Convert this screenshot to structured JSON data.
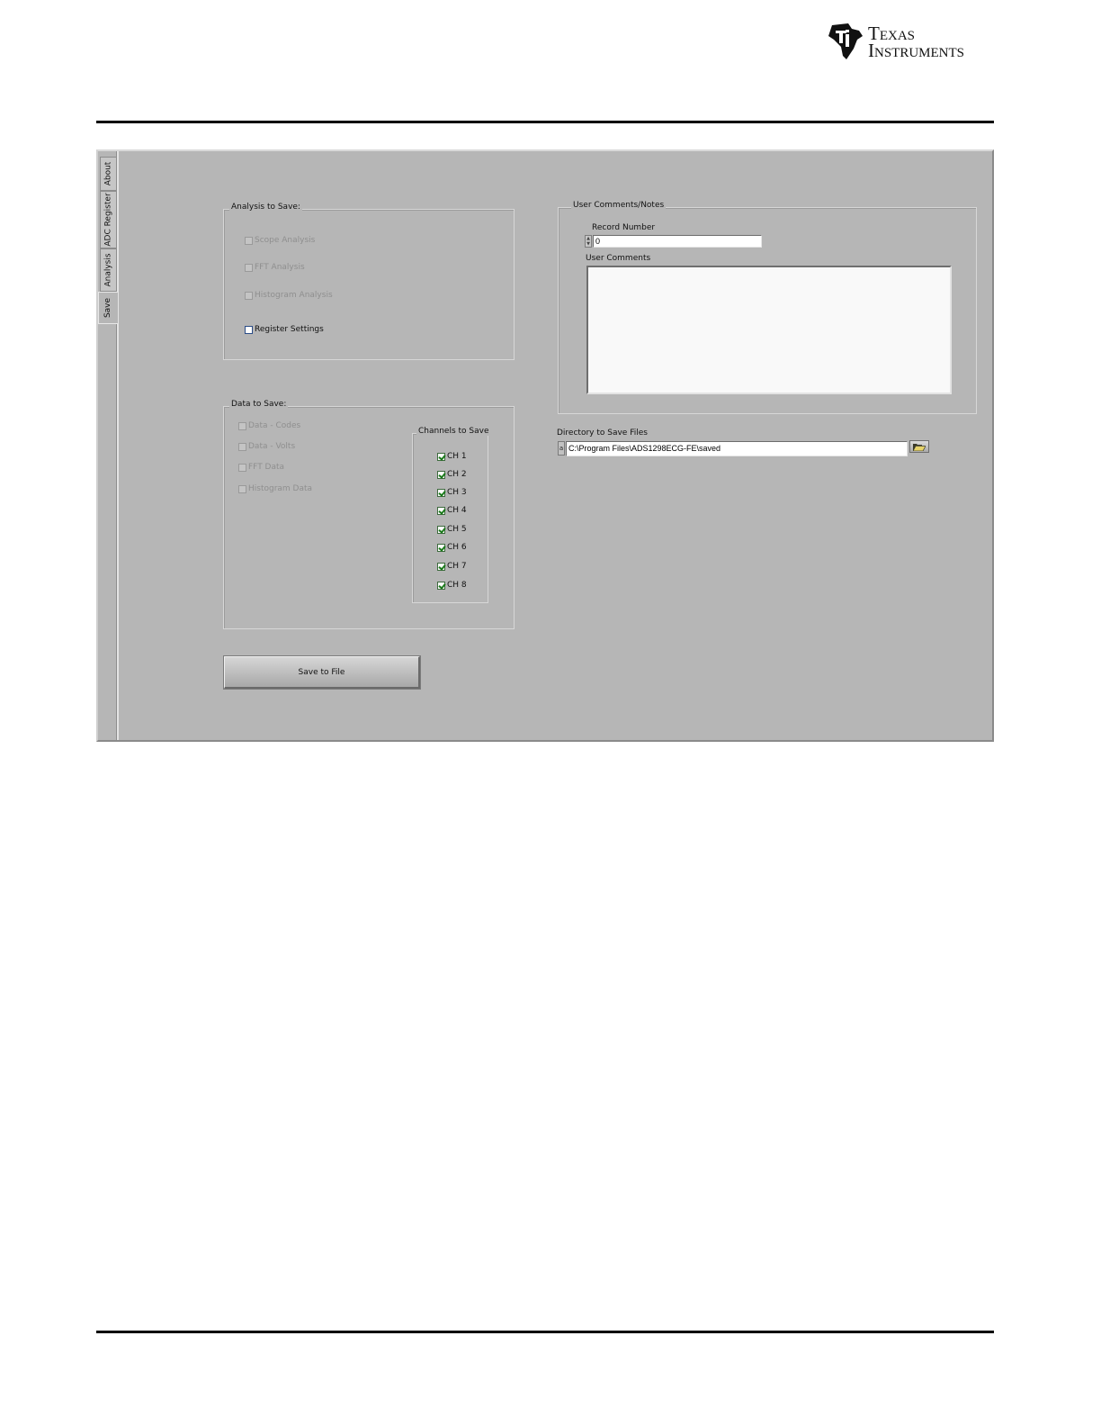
{
  "brand": {
    "line1": "Texas",
    "line2": "Instruments"
  },
  "tabs": [
    {
      "label": "About",
      "active": false
    },
    {
      "label": "ADC Register",
      "active": false
    },
    {
      "label": "Analysis",
      "active": false
    },
    {
      "label": "Save",
      "active": true
    }
  ],
  "analysis_group": {
    "title": "Analysis to Save:",
    "items": [
      {
        "label": "Scope Analysis",
        "checked": false,
        "enabled": false
      },
      {
        "label": "FFT Analysis",
        "checked": false,
        "enabled": false
      },
      {
        "label": "Histogram Analysis",
        "checked": false,
        "enabled": false
      },
      {
        "label": "Register Settings",
        "checked": false,
        "enabled": true
      }
    ]
  },
  "data_group": {
    "title": "Data to Save:",
    "items": [
      {
        "label": "Data - Codes",
        "checked": false,
        "enabled": false
      },
      {
        "label": "Data - Volts",
        "checked": false,
        "enabled": false
      },
      {
        "label": "FFT Data",
        "checked": false,
        "enabled": false
      },
      {
        "label": "Histogram Data",
        "checked": false,
        "enabled": false
      }
    ]
  },
  "channels_group": {
    "title": "Channels to Save",
    "items": [
      {
        "label": "CH 1",
        "checked": true
      },
      {
        "label": "CH 2",
        "checked": true
      },
      {
        "label": "CH 3",
        "checked": true
      },
      {
        "label": "CH 4",
        "checked": true
      },
      {
        "label": "CH 5",
        "checked": true
      },
      {
        "label": "CH 6",
        "checked": true
      },
      {
        "label": "CH 7",
        "checked": true
      },
      {
        "label": "CH 8",
        "checked": true
      }
    ]
  },
  "comments_group": {
    "title": "User Comments/Notes",
    "record_number_label": "Record Number",
    "record_number_value": "0",
    "user_comments_label": "User Comments",
    "user_comments_value": ""
  },
  "directory": {
    "label": "Directory to Save Files",
    "value": "C:\\Program Files\\ADS1298ECG-FE\\saved",
    "path_icon": "path-icon",
    "browse_icon": "folder-open-icon"
  },
  "save_button_label": "Save to File",
  "colors": {
    "panel_bg": "#b6b6b6",
    "check_green": "#1a7a1a"
  }
}
